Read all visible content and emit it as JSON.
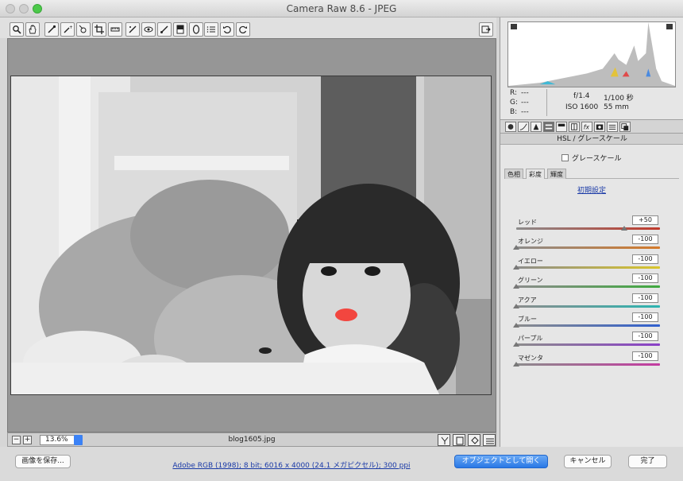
{
  "window": {
    "title": "Camera Raw 8.6  -  JPEG"
  },
  "toolbar": {
    "tools": [
      "zoom-icon",
      "hand-icon",
      "white-balance-icon",
      "color-sampler-icon",
      "target-adjust-icon",
      "crop-icon",
      "straighten-icon",
      "spot-removal-icon",
      "red-eye-icon",
      "adjustment-brush-icon",
      "graduated-filter-icon",
      "radial-filter-icon",
      "list-icon",
      "rotate-ccw-icon",
      "rotate-cw-icon"
    ],
    "fullscreen_icon": "fullscreen-icon"
  },
  "preview": {
    "zoom_value": "13.6%",
    "filename": "blog1605.jpg"
  },
  "histogram": {
    "r_label": "R:",
    "g_label": "G:",
    "b_label": "B:",
    "r_value": "---",
    "g_value": "---",
    "b_value": "---",
    "aperture": "f/1.4",
    "shutter": "1/100 秒",
    "iso": "ISO 1600",
    "focal": "55 mm"
  },
  "panel": {
    "section_title": "HSL / グレースケール",
    "grayscale_label": "グレースケール",
    "subtabs": [
      "色相",
      "彩度",
      "輝度"
    ],
    "defaults_link": "初期設定",
    "sliders": [
      {
        "label": "レッド",
        "value": "+50",
        "level": 0.75,
        "color": "#c0392b"
      },
      {
        "label": "オレンジ",
        "value": "-100",
        "level": 0.0,
        "color": "#d47a2a"
      },
      {
        "label": "イエロー",
        "value": "-100",
        "level": 0.0,
        "color": "#d9c52b"
      },
      {
        "label": "グリーン",
        "value": "-100",
        "level": 0.0,
        "color": "#3fa93f"
      },
      {
        "label": "アクア",
        "value": "-100",
        "level": 0.0,
        "color": "#2cb4b0"
      },
      {
        "label": "ブルー",
        "value": "-100",
        "level": 0.0,
        "color": "#2f5fcf"
      },
      {
        "label": "パープル",
        "value": "-100",
        "level": 0.0,
        "color": "#8a3fc8"
      },
      {
        "label": "マゼンタ",
        "value": "-100",
        "level": 0.0,
        "color": "#c43aa0"
      }
    ]
  },
  "footer": {
    "save_label": "画像を保存...",
    "workflow_link": "Adobe RGB (1998); 8 bit; 6016 x 4000 (24.1 メガピクセル); 300 ppi",
    "open_label": "オブジェクトとして開く",
    "cancel_label": "キャンセル",
    "done_label": "完了"
  }
}
